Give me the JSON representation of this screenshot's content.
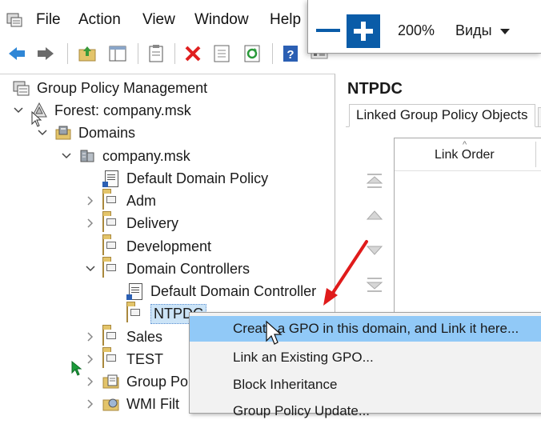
{
  "menubar": {
    "items": [
      "File",
      "Action",
      "View",
      "Window",
      "Help"
    ]
  },
  "toolbar": {
    "buttons": [
      "back-icon",
      "forward-icon",
      "up-folder-icon",
      "show-hide-tree-icon",
      "clipboard-icon",
      "delete-icon",
      "properties-icon",
      "refresh-icon",
      "help-icon",
      "view-icon"
    ]
  },
  "zoom": {
    "value": "200%",
    "views_label": "Виды"
  },
  "tree": {
    "root": "Group Policy Management",
    "forest": "Forest: company.msk",
    "domains": "Domains",
    "domain": "company.msk",
    "items": [
      "Default Domain Policy",
      "Adm",
      "Delivery",
      "Development",
      "Domain Controllers",
      "Default Domain Controller",
      "NTPDC",
      "Sales",
      "TEST",
      "Group Po",
      "WMI Filt"
    ]
  },
  "right_pane": {
    "title": "NTPDC",
    "tab_label": "Linked Group Policy Objects",
    "column_header": "Link Order",
    "sort_caret": "^"
  },
  "context_menu": {
    "items": [
      "Create a GPO in this domain, and Link it here...",
      "Link an Existing GPO...",
      "Block Inheritance",
      "Group Policy Update..."
    ]
  },
  "colors": {
    "accent_blue": "#0a5ca8",
    "highlight": "#91c9f7",
    "arrow_red": "#e01b1b",
    "cursor_green": "#1a9c3a"
  }
}
